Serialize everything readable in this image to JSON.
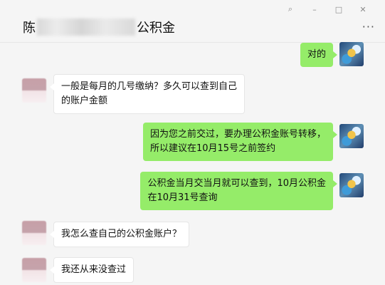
{
  "window": {
    "pin_glyph": "⌕",
    "minimize_glyph": "–",
    "maximize_glyph": "□",
    "close_glyph": "✕"
  },
  "header": {
    "title_prefix": "陈",
    "title_suffix": "公积金",
    "more_glyph": "···"
  },
  "messages": [
    {
      "sender": "self",
      "lines": [
        "对的"
      ]
    },
    {
      "sender": "other",
      "lines": [
        "一般是每月的几号缴纳？多久可以查到自己",
        "的账户金额"
      ]
    },
    {
      "sender": "self",
      "lines": [
        "因为您之前交过，要办理公积金账号转移，",
        "所以建议在10月15号之前签约"
      ]
    },
    {
      "sender": "self",
      "lines": [
        "公积金当月交当月就可以查到，10月公积金",
        "在10月31号查询"
      ]
    },
    {
      "sender": "other",
      "lines": [
        "我怎么查自己的公积金账户？"
      ]
    },
    {
      "sender": "other",
      "lines": [
        "我还从来没查过"
      ]
    }
  ],
  "colors": {
    "self_bubble": "#95ec69",
    "other_bubble": "#ffffff",
    "background": "#f5f5f5"
  }
}
